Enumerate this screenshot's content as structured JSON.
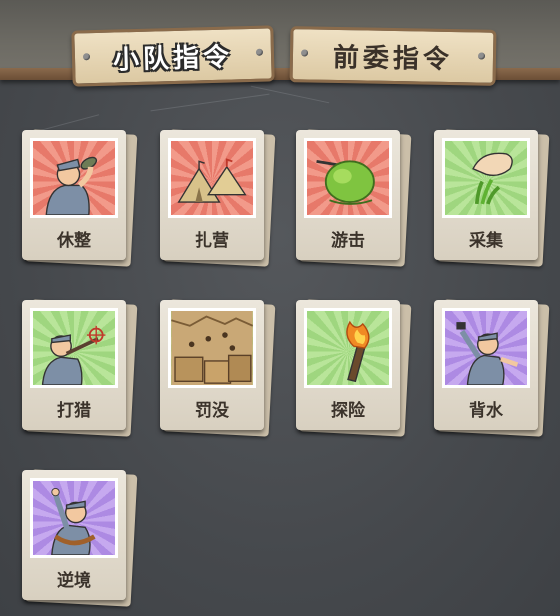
{
  "tabs": [
    {
      "label": "小队指令",
      "active": true
    },
    {
      "label": "前委指令",
      "active": false
    }
  ],
  "commands": [
    {
      "label": "休整",
      "icon": "soldier-drinking-icon",
      "theme": "red"
    },
    {
      "label": "扎营",
      "icon": "tents-icon",
      "theme": "red"
    },
    {
      "label": "游击",
      "icon": "bush-rifle-icon",
      "theme": "red"
    },
    {
      "label": "采集",
      "icon": "hand-picking-grass-icon",
      "theme": "green"
    },
    {
      "label": "打猎",
      "icon": "soldier-aiming-icon",
      "theme": "green"
    },
    {
      "label": "罚没",
      "icon": "crates-icon",
      "theme": "green"
    },
    {
      "label": "探险",
      "icon": "torch-icon",
      "theme": "green"
    },
    {
      "label": "背水",
      "icon": "soldier-pistol-icon",
      "theme": "purple"
    },
    {
      "label": "逆境",
      "icon": "soldier-cheering-icon",
      "theme": "purple"
    }
  ]
}
